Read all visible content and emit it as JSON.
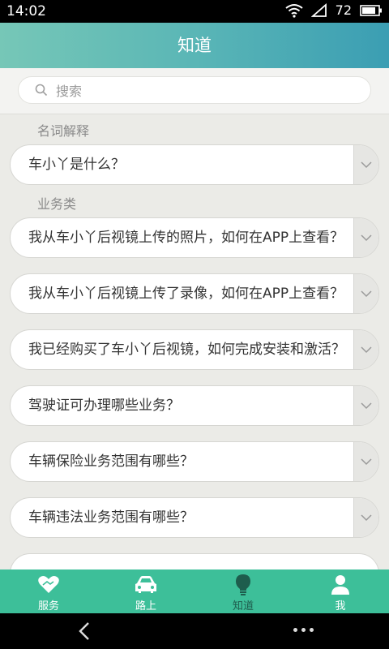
{
  "status_bar": {
    "time": "14:02",
    "battery": "72"
  },
  "header": {
    "title": "知道"
  },
  "search": {
    "placeholder": "搜索"
  },
  "sections": [
    {
      "label": "名词解释",
      "items": [
        "车小丫是什么？"
      ]
    },
    {
      "label": "业务类",
      "items": [
        "我从车小丫后视镜上传的照片，如何在APP上查看？",
        "我从车小丫后视镜上传了录像，如何在APP上查看？",
        "我已经购买了车小丫后视镜，如何完成安装和激活？",
        "驾驶证可办理哪些业务？",
        "车辆保险业务范围有哪些？",
        "车辆违法业务范围有哪些？"
      ]
    }
  ],
  "tabs": [
    {
      "label": "服务",
      "icon": "heart-handshake-icon"
    },
    {
      "label": "路上",
      "icon": "car-icon"
    },
    {
      "label": "知道",
      "icon": "lightbulb-icon",
      "active": true
    },
    {
      "label": "我",
      "icon": "person-icon"
    }
  ],
  "colors": {
    "header_start": "#76c7b7",
    "header_end": "#3b9eb3",
    "tabbar": "#3dbf99",
    "active_tab": "#1e5d4d"
  }
}
